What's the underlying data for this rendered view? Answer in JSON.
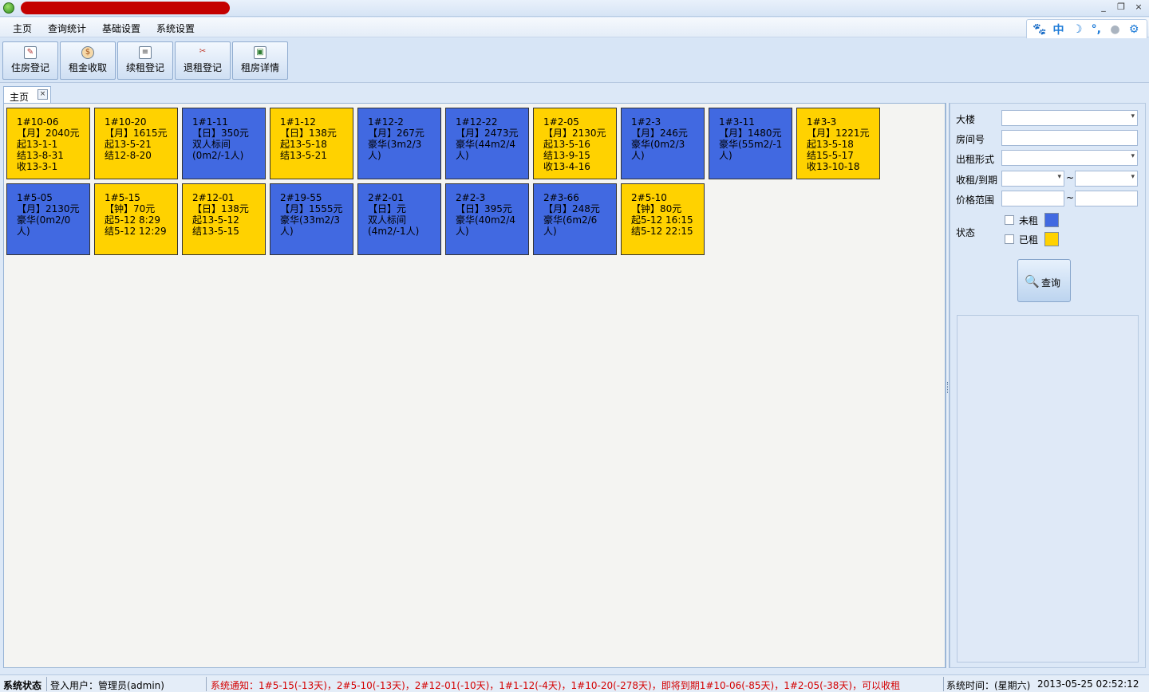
{
  "colors": {
    "vacant": "#4169e1",
    "rented": "#ffd200",
    "notice": "#d40000"
  },
  "window": {
    "title_redacted": true,
    "buttons": [
      "_",
      "❐",
      "×"
    ]
  },
  "menu": [
    "主页",
    "查询统计",
    "基础设置",
    "系统设置"
  ],
  "toolbar": [
    {
      "label": "住房登记",
      "icon": "check-in-icon"
    },
    {
      "label": "租金收取",
      "icon": "money-bag-icon"
    },
    {
      "label": "续租登记",
      "icon": "ledger-icon"
    },
    {
      "label": "退租登记",
      "icon": "scissors-icon"
    },
    {
      "label": "租房详情",
      "icon": "detail-icon"
    }
  ],
  "tab": {
    "label": "主页",
    "close": "×"
  },
  "rooms": [
    {
      "status": "rented",
      "lines": [
        "1#10-06",
        "【月】2040元",
        "起13-1-1",
        "结13-8-31",
        "收13-3-1"
      ]
    },
    {
      "status": "rented",
      "lines": [
        "1#10-20",
        "【月】1615元",
        "起13-5-21",
        "结12-8-20"
      ]
    },
    {
      "status": "vacant",
      "lines": [
        "1#1-11",
        "【日】350元",
        "双人标间",
        "(0m2/-1人)"
      ]
    },
    {
      "status": "rented",
      "lines": [
        "1#1-12",
        "【日】138元",
        "起13-5-18",
        "结13-5-21"
      ]
    },
    {
      "status": "vacant",
      "lines": [
        "1#12-2",
        "【月】267元",
        "豪华(3m2/3",
        "人)"
      ]
    },
    {
      "status": "vacant",
      "lines": [
        "1#12-22",
        "【月】2473元",
        "豪华(44m2/4",
        "人)"
      ]
    },
    {
      "status": "rented",
      "lines": [
        "1#2-05",
        "【月】2130元",
        "起13-5-16",
        "结13-9-15",
        "收13-4-16"
      ]
    },
    {
      "status": "vacant",
      "lines": [
        "1#2-3",
        "【月】246元",
        "豪华(0m2/3",
        "人)"
      ]
    },
    {
      "status": "vacant",
      "lines": [
        "1#3-11",
        "【月】1480元",
        "豪华(55m2/-1",
        "人)"
      ]
    },
    {
      "status": "rented",
      "lines": [
        "1#3-3",
        "【月】1221元",
        "起13-5-18",
        "结15-5-17",
        "收13-10-18"
      ]
    },
    {
      "status": "vacant",
      "lines": [
        "1#5-05",
        "【月】2130元",
        "豪华(0m2/0",
        "人)"
      ]
    },
    {
      "status": "rented",
      "lines": [
        "1#5-15",
        "【钟】70元",
        "起5-12 8:29",
        "结5-12 12:29"
      ]
    },
    {
      "status": "rented",
      "lines": [
        "2#12-01",
        "【日】138元",
        "起13-5-12",
        "结13-5-15"
      ]
    },
    {
      "status": "vacant",
      "lines": [
        "2#19-55",
        "【月】1555元",
        "豪华(33m2/3",
        "人)"
      ]
    },
    {
      "status": "vacant",
      "lines": [
        "2#2-01",
        "【日】元",
        "双人标间",
        "(4m2/-1人)"
      ]
    },
    {
      "status": "vacant",
      "lines": [
        "2#2-3",
        "【日】395元",
        "豪华(40m2/4",
        "人)"
      ]
    },
    {
      "status": "vacant",
      "lines": [
        "2#3-66",
        "【月】248元",
        "豪华(6m2/6",
        "人)"
      ]
    },
    {
      "status": "rented",
      "lines": [
        "2#5-10",
        "【钟】80元",
        "起5-12 16:15",
        "结5-12 22:15"
      ]
    }
  ],
  "filter": {
    "building_label": "大楼",
    "building_value": "",
    "room_no_label": "房间号",
    "room_no_value": "",
    "rent_type_label": "出租形式",
    "rent_type_value": "",
    "date_label": "收租/到期",
    "date_from": "",
    "date_to": "",
    "price_label": "价格范围",
    "price_from": "",
    "price_to": "",
    "tilde": "~",
    "status_label": "状态",
    "vacant_label": "未租",
    "rented_label": "已租",
    "vacant_checked": false,
    "rented_checked": false,
    "query_label": "查询"
  },
  "status": {
    "title": "系统状态",
    "user": "登入用户：管理员(admin)",
    "notice": "系统通知：1#5-15(-13天)，2#5-10(-13天)，2#12-01(-10天)，1#1-12(-4天)，1#10-20(-278天)，即将到期1#10-06(-85天)，1#2-05(-38天)，可以收租",
    "time_label": "系统时间：(星期六)",
    "time_value": "2013-05-25 02:52:12"
  }
}
